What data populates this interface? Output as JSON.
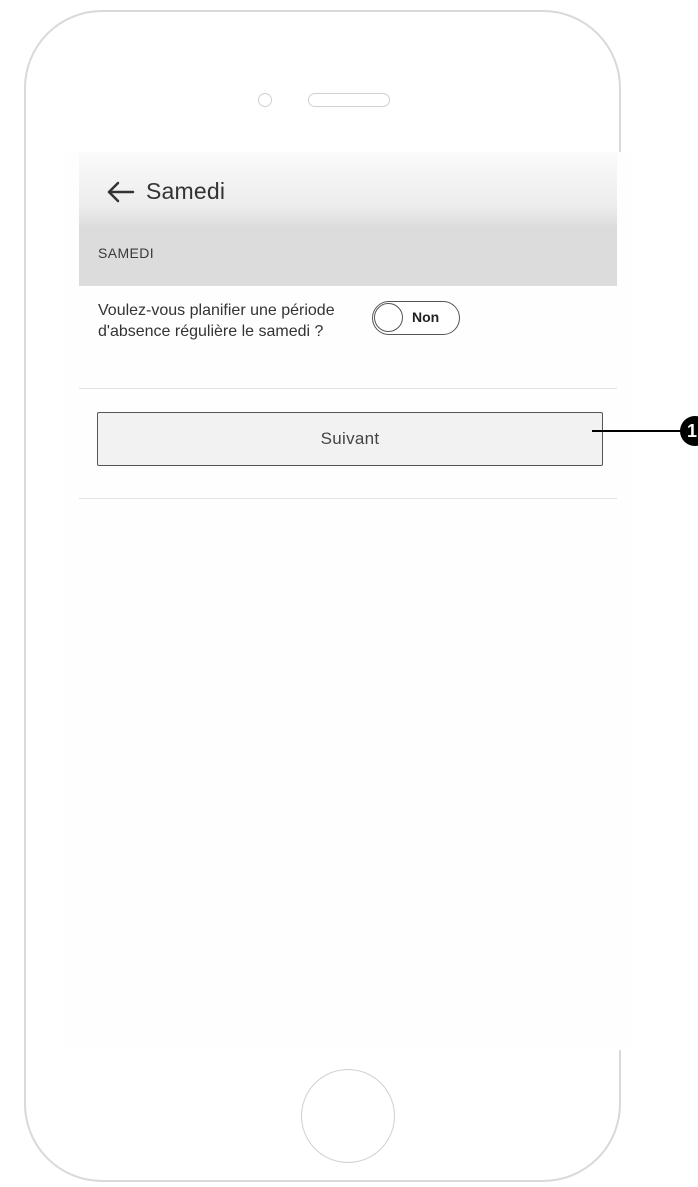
{
  "header": {
    "back_icon": "arrow-left-icon",
    "title": "Samedi"
  },
  "section": {
    "label": "SAMEDI"
  },
  "question": {
    "text": "Voulez-vous planifier une période d'absence régulière le samedi ?",
    "toggle": {
      "label": "Non",
      "state": "off"
    }
  },
  "actions": {
    "next_label": "Suivant"
  },
  "annotations": {
    "callout_number": "1"
  }
}
